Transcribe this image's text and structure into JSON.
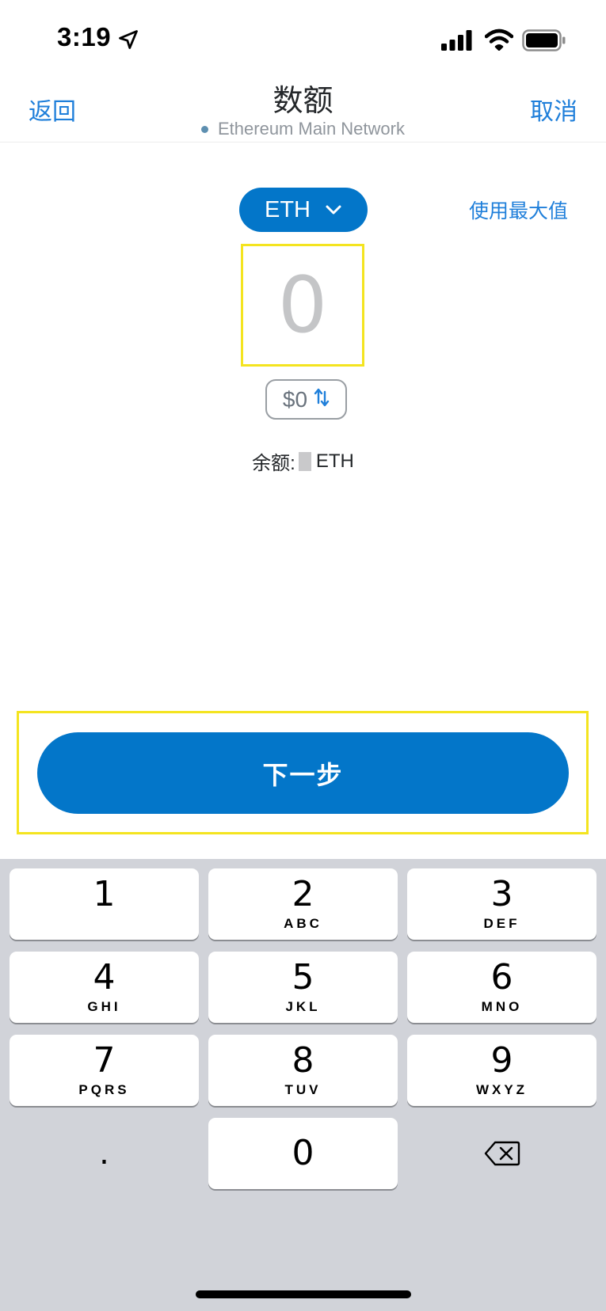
{
  "status_bar": {
    "time": "3:19",
    "icons": [
      "location-arrow-icon",
      "cellular-signal-icon",
      "wifi-icon",
      "battery-icon"
    ]
  },
  "header": {
    "back_label": "返回",
    "title": "数额",
    "network": "Ethereum Main Network",
    "cancel_label": "取消"
  },
  "amount": {
    "token": "ETH",
    "use_max_label": "使用最大值",
    "placeholder": "0",
    "fiat_value": "$0",
    "balance_label": "余额:",
    "balance_unit": "ETH"
  },
  "next_button": {
    "label": "下一步"
  },
  "keypad": {
    "keys": [
      {
        "digit": "1",
        "letters": ""
      },
      {
        "digit": "2",
        "letters": "ABC"
      },
      {
        "digit": "3",
        "letters": "DEF"
      },
      {
        "digit": "4",
        "letters": "GHI"
      },
      {
        "digit": "5",
        "letters": "JKL"
      },
      {
        "digit": "6",
        "letters": "MNO"
      },
      {
        "digit": "7",
        "letters": "PQRS"
      },
      {
        "digit": "8",
        "letters": "TUV"
      },
      {
        "digit": "9",
        "letters": "WXYZ"
      }
    ],
    "dot": ".",
    "zero": "0",
    "delete_icon": "backspace-icon"
  },
  "colors": {
    "accent": "#0376c9",
    "link": "#1f7fda",
    "highlight": "#f4e41f",
    "keypad_bg": "#d1d3d9"
  }
}
